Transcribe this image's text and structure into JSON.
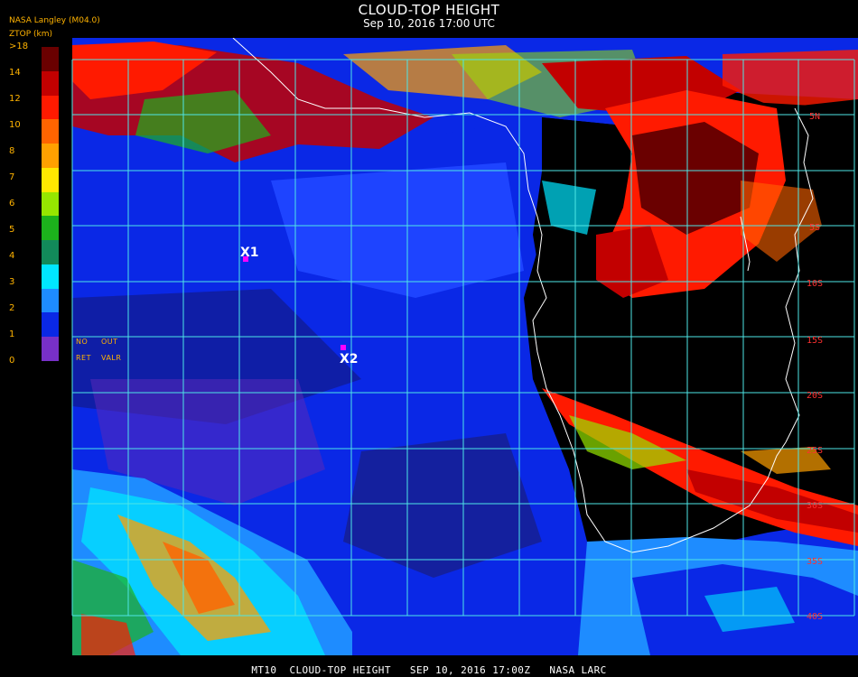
{
  "header": {
    "title": "CLOUD-TOP HEIGHT",
    "datetime": "Sep 10, 2016 17:00 UTC",
    "agency": "NASA Langley (M04.0)",
    "parameter": "ZTOP (km)"
  },
  "colorbar": {
    "ticks": [
      ">18",
      "14",
      "12",
      "10",
      "8",
      "7",
      "6",
      "5",
      "4",
      "3",
      "2",
      "1",
      "0"
    ],
    "colors": [
      "#6a0000",
      "#c20000",
      "#ff1a00",
      "#ff6400",
      "#ffa000",
      "#ffe800",
      "#96e600",
      "#1cb21c",
      "#128a5a",
      "#00e6ff",
      "#1e8cff",
      "#0a28e6",
      "#7830c8"
    ],
    "no_ret_label": "NO\nRET",
    "out_valr_label": "OUT\nVALR"
  },
  "map": {
    "latitude_labels": [
      "5N",
      "5S",
      "10S",
      "15S",
      "20S",
      "25S",
      "30S",
      "35S",
      "40S"
    ],
    "markers": [
      {
        "label": "X1",
        "color": "#ff00ff"
      },
      {
        "label": "X2",
        "color": "#ff00ff"
      }
    ],
    "grid_color": "#4ee6e6",
    "coast_color": "#ffffff"
  },
  "footer": {
    "text": "MT10  CLOUD-TOP HEIGHT   SEP 10, 2016 17:00Z   NASA LARC"
  }
}
